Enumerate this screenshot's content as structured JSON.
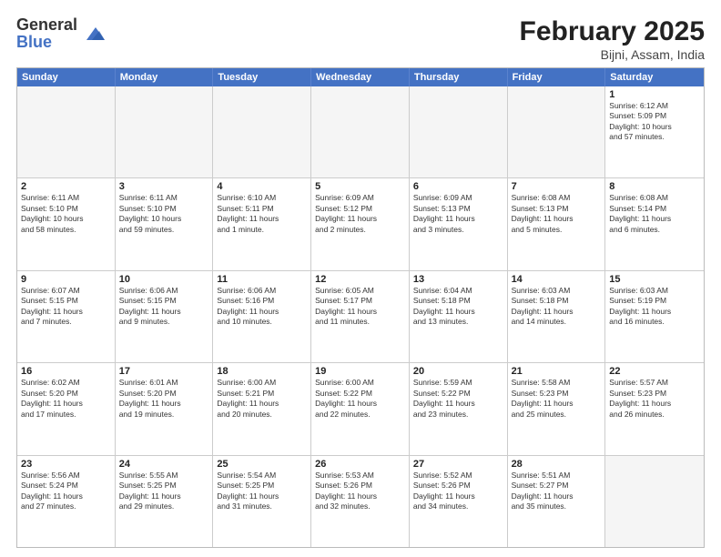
{
  "header": {
    "logo_general": "General",
    "logo_blue": "Blue",
    "month_title": "February 2025",
    "location": "Bijni, Assam, India"
  },
  "weekdays": [
    "Sunday",
    "Monday",
    "Tuesday",
    "Wednesday",
    "Thursday",
    "Friday",
    "Saturday"
  ],
  "rows": [
    [
      {
        "day": "",
        "info": "",
        "empty": true
      },
      {
        "day": "",
        "info": "",
        "empty": true
      },
      {
        "day": "",
        "info": "",
        "empty": true
      },
      {
        "day": "",
        "info": "",
        "empty": true
      },
      {
        "day": "",
        "info": "",
        "empty": true
      },
      {
        "day": "",
        "info": "",
        "empty": true
      },
      {
        "day": "1",
        "info": "Sunrise: 6:12 AM\nSunset: 5:09 PM\nDaylight: 10 hours\nand 57 minutes.",
        "empty": false
      }
    ],
    [
      {
        "day": "2",
        "info": "Sunrise: 6:11 AM\nSunset: 5:10 PM\nDaylight: 10 hours\nand 58 minutes.",
        "empty": false
      },
      {
        "day": "3",
        "info": "Sunrise: 6:11 AM\nSunset: 5:10 PM\nDaylight: 10 hours\nand 59 minutes.",
        "empty": false
      },
      {
        "day": "4",
        "info": "Sunrise: 6:10 AM\nSunset: 5:11 PM\nDaylight: 11 hours\nand 1 minute.",
        "empty": false
      },
      {
        "day": "5",
        "info": "Sunrise: 6:09 AM\nSunset: 5:12 PM\nDaylight: 11 hours\nand 2 minutes.",
        "empty": false
      },
      {
        "day": "6",
        "info": "Sunrise: 6:09 AM\nSunset: 5:13 PM\nDaylight: 11 hours\nand 3 minutes.",
        "empty": false
      },
      {
        "day": "7",
        "info": "Sunrise: 6:08 AM\nSunset: 5:13 PM\nDaylight: 11 hours\nand 5 minutes.",
        "empty": false
      },
      {
        "day": "8",
        "info": "Sunrise: 6:08 AM\nSunset: 5:14 PM\nDaylight: 11 hours\nand 6 minutes.",
        "empty": false
      }
    ],
    [
      {
        "day": "9",
        "info": "Sunrise: 6:07 AM\nSunset: 5:15 PM\nDaylight: 11 hours\nand 7 minutes.",
        "empty": false
      },
      {
        "day": "10",
        "info": "Sunrise: 6:06 AM\nSunset: 5:15 PM\nDaylight: 11 hours\nand 9 minutes.",
        "empty": false
      },
      {
        "day": "11",
        "info": "Sunrise: 6:06 AM\nSunset: 5:16 PM\nDaylight: 11 hours\nand 10 minutes.",
        "empty": false
      },
      {
        "day": "12",
        "info": "Sunrise: 6:05 AM\nSunset: 5:17 PM\nDaylight: 11 hours\nand 11 minutes.",
        "empty": false
      },
      {
        "day": "13",
        "info": "Sunrise: 6:04 AM\nSunset: 5:18 PM\nDaylight: 11 hours\nand 13 minutes.",
        "empty": false
      },
      {
        "day": "14",
        "info": "Sunrise: 6:03 AM\nSunset: 5:18 PM\nDaylight: 11 hours\nand 14 minutes.",
        "empty": false
      },
      {
        "day": "15",
        "info": "Sunrise: 6:03 AM\nSunset: 5:19 PM\nDaylight: 11 hours\nand 16 minutes.",
        "empty": false
      }
    ],
    [
      {
        "day": "16",
        "info": "Sunrise: 6:02 AM\nSunset: 5:20 PM\nDaylight: 11 hours\nand 17 minutes.",
        "empty": false
      },
      {
        "day": "17",
        "info": "Sunrise: 6:01 AM\nSunset: 5:20 PM\nDaylight: 11 hours\nand 19 minutes.",
        "empty": false
      },
      {
        "day": "18",
        "info": "Sunrise: 6:00 AM\nSunset: 5:21 PM\nDaylight: 11 hours\nand 20 minutes.",
        "empty": false
      },
      {
        "day": "19",
        "info": "Sunrise: 6:00 AM\nSunset: 5:22 PM\nDaylight: 11 hours\nand 22 minutes.",
        "empty": false
      },
      {
        "day": "20",
        "info": "Sunrise: 5:59 AM\nSunset: 5:22 PM\nDaylight: 11 hours\nand 23 minutes.",
        "empty": false
      },
      {
        "day": "21",
        "info": "Sunrise: 5:58 AM\nSunset: 5:23 PM\nDaylight: 11 hours\nand 25 minutes.",
        "empty": false
      },
      {
        "day": "22",
        "info": "Sunrise: 5:57 AM\nSunset: 5:23 PM\nDaylight: 11 hours\nand 26 minutes.",
        "empty": false
      }
    ],
    [
      {
        "day": "23",
        "info": "Sunrise: 5:56 AM\nSunset: 5:24 PM\nDaylight: 11 hours\nand 27 minutes.",
        "empty": false
      },
      {
        "day": "24",
        "info": "Sunrise: 5:55 AM\nSunset: 5:25 PM\nDaylight: 11 hours\nand 29 minutes.",
        "empty": false
      },
      {
        "day": "25",
        "info": "Sunrise: 5:54 AM\nSunset: 5:25 PM\nDaylight: 11 hours\nand 31 minutes.",
        "empty": false
      },
      {
        "day": "26",
        "info": "Sunrise: 5:53 AM\nSunset: 5:26 PM\nDaylight: 11 hours\nand 32 minutes.",
        "empty": false
      },
      {
        "day": "27",
        "info": "Sunrise: 5:52 AM\nSunset: 5:26 PM\nDaylight: 11 hours\nand 34 minutes.",
        "empty": false
      },
      {
        "day": "28",
        "info": "Sunrise: 5:51 AM\nSunset: 5:27 PM\nDaylight: 11 hours\nand 35 minutes.",
        "empty": false
      },
      {
        "day": "",
        "info": "",
        "empty": true
      }
    ]
  ]
}
